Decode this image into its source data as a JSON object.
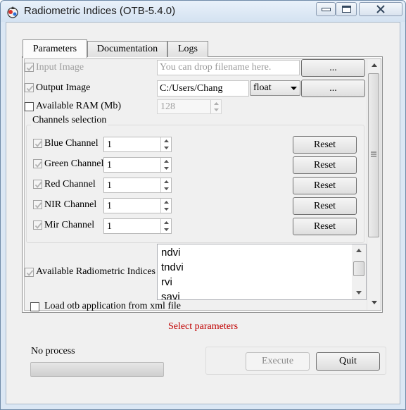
{
  "window": {
    "title": "Radiometric Indices (OTB-5.4.0)"
  },
  "tabs": [
    {
      "label": "Parameters",
      "active": true
    },
    {
      "label": "Documentation",
      "active": false
    },
    {
      "label": "Logs",
      "active": false
    }
  ],
  "params": {
    "input_image": {
      "label": "Input Image",
      "placeholder": "You can drop filename here.",
      "browse": "..."
    },
    "output_image": {
      "label": "Output Image",
      "value": "C:/Users/Chang",
      "type_value": "float",
      "browse": "..."
    },
    "ram": {
      "label": "Available RAM (Mb)",
      "value": "128"
    },
    "channels": {
      "title": "Channels selection",
      "reset_label": "Reset",
      "items": [
        {
          "label": "Blue Channel",
          "value": "1"
        },
        {
          "label": "Green Channel",
          "value": "1"
        },
        {
          "label": "Red Channel",
          "value": "1"
        },
        {
          "label": "NIR Channel",
          "value": "1"
        },
        {
          "label": "Mir Channel",
          "value": "1"
        }
      ]
    },
    "indices": {
      "label": "Available Radiometric Indices",
      "items": [
        "ndvi",
        "tndvi",
        "rvi",
        "savi"
      ]
    },
    "load_xml": {
      "label": "Load otb application from xml file"
    }
  },
  "status": {
    "text": "Select parameters",
    "color": "#c00000"
  },
  "progress": {
    "label": "No process",
    "value": 0
  },
  "actions": {
    "execute": "Execute",
    "quit": "Quit"
  }
}
